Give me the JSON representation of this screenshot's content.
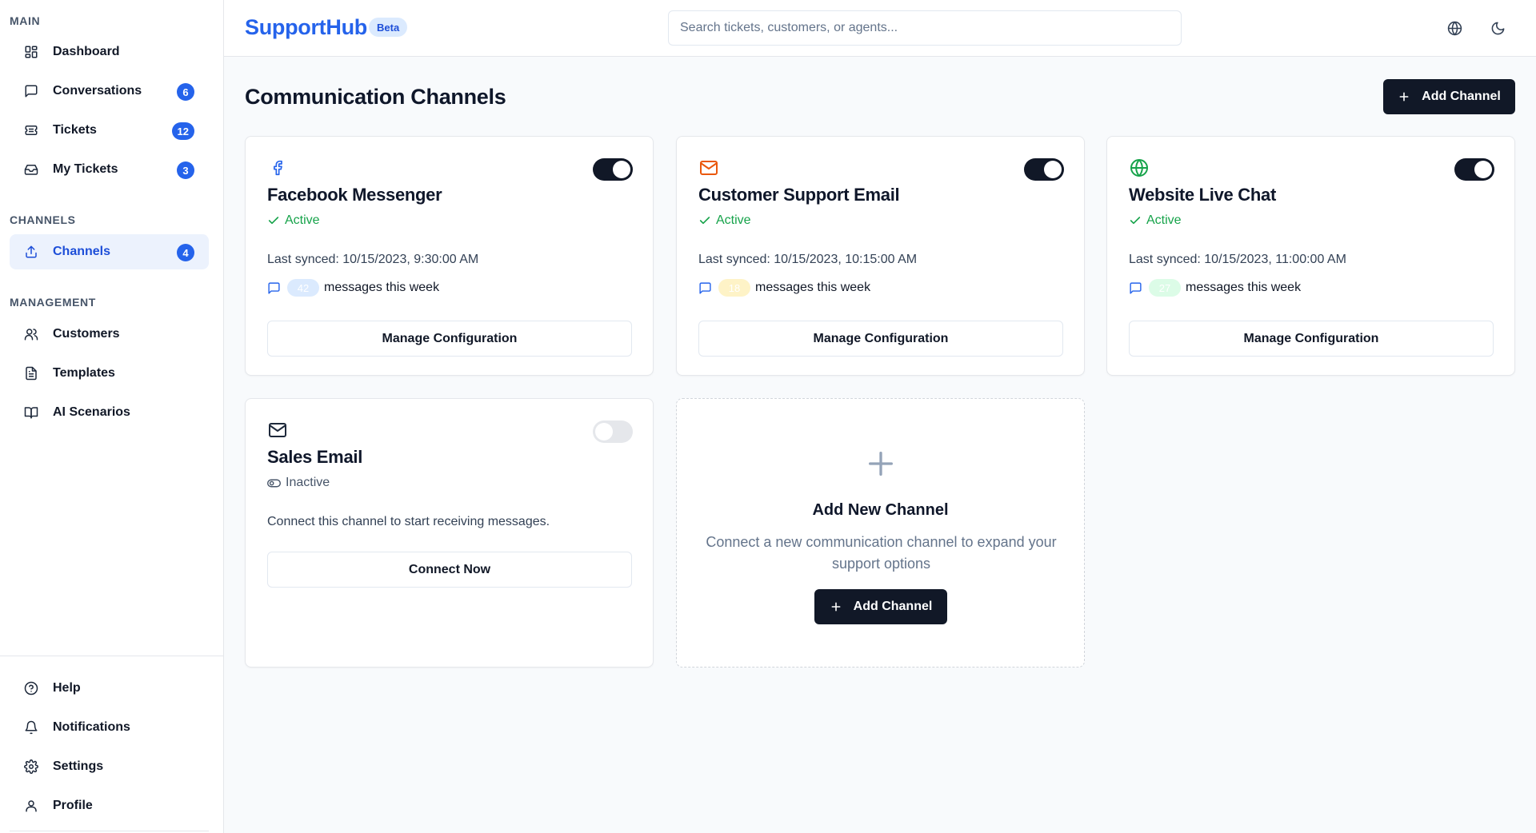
{
  "sidebar": {
    "sections": {
      "main": "MAIN",
      "channels": "CHANNELS",
      "management": "MANAGEMENT"
    },
    "main_items": [
      {
        "label": "Dashboard",
        "icon": "dashboard-icon"
      },
      {
        "label": "Conversations",
        "icon": "chat-bubble-icon",
        "badge": "6"
      },
      {
        "label": "Tickets",
        "icon": "ticket-icon",
        "badge": "12"
      },
      {
        "label": "My Tickets",
        "icon": "inbox-icon",
        "badge": "3"
      }
    ],
    "channel_items": [
      {
        "label": "Channels",
        "icon": "upload-icon",
        "badge": "4",
        "active": true
      }
    ],
    "management_items": [
      {
        "label": "Customers",
        "icon": "users-icon"
      },
      {
        "label": "Templates",
        "icon": "document-icon"
      },
      {
        "label": "AI Scenarios",
        "icon": "book-open-icon"
      }
    ],
    "bottom_items": [
      {
        "label": "Help",
        "icon": "help-circle-icon"
      },
      {
        "label": "Notifications",
        "icon": "bell-icon"
      },
      {
        "label": "Settings",
        "icon": "gear-icon"
      },
      {
        "label": "Profile",
        "icon": "user-icon"
      }
    ]
  },
  "header": {
    "logo": "SupportHub",
    "beta": "Beta",
    "search_placeholder": "Search tickets, customers, or agents...",
    "icons": [
      "globe-icon",
      "moon-icon"
    ]
  },
  "main": {
    "title": "Communication Channels",
    "add_channel_label": "Add Channel",
    "colors": {
      "accent": "#2563eb",
      "dark": "#111827",
      "success": "#16a34a",
      "email_orange": "#ea580c"
    },
    "channels": [
      {
        "name": "Facebook Messenger",
        "icon": "facebook-icon",
        "status": "Active",
        "enabled": true,
        "last_synced": "Last synced: 10/15/2023, 9:30:00 AM",
        "count": "42",
        "messages_suffix": "messages this week",
        "action": "Manage Configuration"
      },
      {
        "name": "Customer Support Email",
        "icon": "mail-icon",
        "status": "Active",
        "enabled": true,
        "last_synced": "Last synced: 10/15/2023, 10:15:00 AM",
        "count": "18",
        "messages_suffix": "messages this week",
        "action": "Manage Configuration"
      },
      {
        "name": "Website Live Chat",
        "icon": "globe-icon",
        "status": "Active",
        "enabled": true,
        "last_synced": "Last synced: 10/15/2023, 11:00:00 AM",
        "count": "27",
        "messages_suffix": "messages this week",
        "action": "Manage Configuration"
      },
      {
        "name": "Sales Email",
        "icon": "mail-icon",
        "status": "Inactive",
        "enabled": false,
        "description": "Connect this channel to start receiving messages.",
        "action": "Connect Now"
      }
    ],
    "add_card": {
      "title": "Add New Channel",
      "description": "Connect a new communication channel to expand your support options",
      "button": "Add Channel"
    }
  }
}
